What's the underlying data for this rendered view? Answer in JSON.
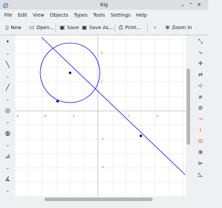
{
  "window": {
    "title": "Kig"
  },
  "menu": [
    "File",
    "Edit",
    "View",
    "Objects",
    "Types",
    "Tools",
    "Settings",
    "Help"
  ],
  "toolbar": {
    "new_label": "New",
    "open_label": "Open...",
    "save_label": "Save",
    "save_as_label": "Save As...",
    "print_label": "Print...",
    "zoom_in_label": "Zoom In"
  },
  "axes": {
    "x_ticks": [
      "6",
      "-4",
      "-2",
      "2",
      "4"
    ],
    "y_ticks": [
      "4",
      "2",
      "-2",
      "-4"
    ]
  },
  "colors": {
    "construction": "#0000ff",
    "grid": "#e0e0e0",
    "axis": "#b0b0b0"
  }
}
